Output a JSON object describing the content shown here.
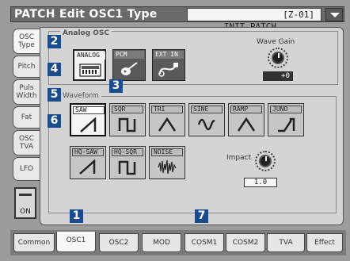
{
  "header": {
    "title": "PATCH Edit OSC1 Type",
    "patch_name": "INIT PATCH",
    "patch_number": "[Z-01]"
  },
  "left_tabs": [
    {
      "label": "OSC\nType"
    },
    {
      "label": "Pitch"
    },
    {
      "label": "Puls\nWidth"
    },
    {
      "label": "Fat"
    },
    {
      "label": "OSC\nTVA"
    },
    {
      "label": "LFO"
    }
  ],
  "switch": {
    "label": "ON"
  },
  "osc_group": {
    "label": "Analog OSC",
    "types": [
      {
        "label": "ANALOG",
        "icon": "keyboard-icon",
        "selected": true
      },
      {
        "label": "PCM",
        "icon": "guitar-icon",
        "selected": false
      },
      {
        "label": "EXT IN",
        "icon": "plug-icon",
        "selected": false
      }
    ]
  },
  "wave_gain": {
    "label": "Wave Gain",
    "value": "+0"
  },
  "wave_group": {
    "label": "Waveform",
    "waves": [
      {
        "label": "SAW",
        "icon": "saw-wave-icon",
        "selected": true
      },
      {
        "label": "SQR",
        "icon": "square-wave-icon",
        "selected": false
      },
      {
        "label": "TRI",
        "icon": "triangle-wave-icon",
        "selected": false
      },
      {
        "label": "SINE",
        "icon": "sine-wave-icon",
        "selected": false
      },
      {
        "label": "RAMP",
        "icon": "ramp-wave-icon",
        "selected": false
      },
      {
        "label": "JUNO",
        "icon": "juno-wave-icon",
        "selected": false
      },
      {
        "label": "HQ-SAW",
        "icon": "hq-saw-wave-icon",
        "selected": false
      },
      {
        "label": "HQ-SQR",
        "icon": "hq-square-wave-icon",
        "selected": false
      },
      {
        "label": "NOISE",
        "icon": "noise-wave-icon",
        "selected": false
      }
    ]
  },
  "impact": {
    "label": "Impact",
    "value": "1.0"
  },
  "bottom_tabs": [
    {
      "label": "Common"
    },
    {
      "label": "OSC1",
      "active": true
    },
    {
      "label": "OSC2"
    },
    {
      "label": "MOD"
    },
    {
      "label": "COSM1"
    },
    {
      "label": "COSM2"
    },
    {
      "label": "TVA"
    },
    {
      "label": "Effect"
    }
  ],
  "callouts": [
    "1",
    "2",
    "3",
    "4",
    "5",
    "6",
    "7"
  ],
  "colors": {
    "callout": "#1a4c8c",
    "screen_bg": "#9c9c9c",
    "panel_bg": "#d4d4d4",
    "title_bar": "#6a6a6a"
  }
}
